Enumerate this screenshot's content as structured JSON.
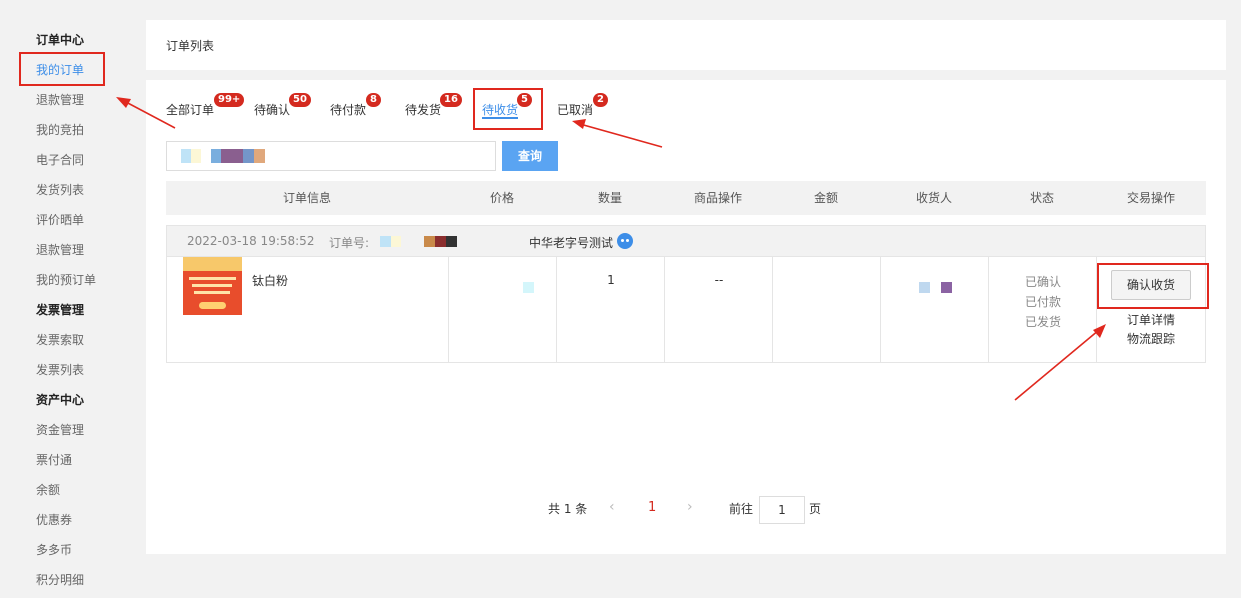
{
  "sidebar": {
    "items": [
      {
        "label": "订单中心",
        "type": "header"
      },
      {
        "label": "我的订单",
        "type": "active"
      },
      {
        "label": "退款管理",
        "type": "link"
      },
      {
        "label": "我的竞拍",
        "type": "link"
      },
      {
        "label": "电子合同",
        "type": "link"
      },
      {
        "label": "发货列表",
        "type": "link"
      },
      {
        "label": "评价晒单",
        "type": "link"
      },
      {
        "label": "退款管理",
        "type": "link"
      },
      {
        "label": "我的预订单",
        "type": "link"
      },
      {
        "label": "发票管理",
        "type": "header"
      },
      {
        "label": "发票索取",
        "type": "link"
      },
      {
        "label": "发票列表",
        "type": "link"
      },
      {
        "label": "资产中心",
        "type": "header"
      },
      {
        "label": "资金管理",
        "type": "link"
      },
      {
        "label": "票付通",
        "type": "link"
      },
      {
        "label": "余额",
        "type": "link"
      },
      {
        "label": "优惠券",
        "type": "link"
      },
      {
        "label": "多多币",
        "type": "link"
      },
      {
        "label": "积分明细",
        "type": "link"
      }
    ]
  },
  "page_title": "订单列表",
  "tabs": [
    {
      "label": "全部订单",
      "badge": "99+"
    },
    {
      "label": "待确认",
      "badge": "50"
    },
    {
      "label": "待付款",
      "badge": "8"
    },
    {
      "label": "待发货",
      "badge": "16"
    },
    {
      "label": "待收货",
      "badge": "5"
    },
    {
      "label": "已取消",
      "badge": "2"
    }
  ],
  "active_tab": "待收货",
  "search": {
    "button_label": "查询"
  },
  "table_headers": [
    "订单信息",
    "价格",
    "数量",
    "商品操作",
    "金额",
    "收货人",
    "状态",
    "交易操作"
  ],
  "order": {
    "time": "2022-03-18 19:58:52",
    "order_no_label": "订单号:",
    "shop_name": "中华老字号测试",
    "product_name": "钛白粉",
    "quantity": "1",
    "goods_action": "--",
    "status": [
      "已确认",
      "已付款",
      "已发货"
    ],
    "confirm_button": "确认收货",
    "detail_link": "订单详情",
    "logistics_link": "物流跟踪"
  },
  "pagination": {
    "total": "共 1 条",
    "prev": "‹",
    "current_page": "1",
    "next": "›",
    "goto_label": "前往",
    "goto_value": "1",
    "page_unit": "页"
  },
  "colors": {
    "accent": "#3d8ee8",
    "badge": "#d42a1f",
    "highlight": "#e0281e",
    "search_button": "#5aa4f2"
  },
  "icons": {
    "shop": "chat-bubble-icon",
    "prev": "chevron-left-icon",
    "next": "chevron-right-icon"
  }
}
